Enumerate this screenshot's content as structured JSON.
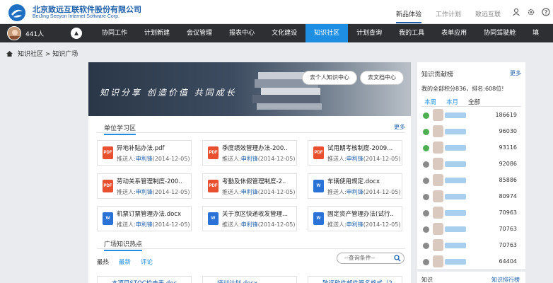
{
  "header": {
    "company_cn": "北京致远互联软件股份有限公司",
    "company_en": "BeiJing Seeyon Internet Software Corp.",
    "links": [
      "新品体验",
      "工作计划",
      "致远互联"
    ]
  },
  "nav": {
    "user_count": "441人",
    "items": [
      "协同工作",
      "计划新建",
      "会议管理",
      "报表中心",
      "文化建设",
      "知识社区",
      "计划查询",
      "我的工具",
      "表单应用",
      "协同驾驶舱",
      "填"
    ],
    "active": "知识社区"
  },
  "breadcrumb": "知识社区 > 知识广场",
  "banner": {
    "slogan": "知识分享  创造价值  共同成长",
    "btn_personal": "去个人知识中心",
    "btn_doc": "去文档中心"
  },
  "learning": {
    "title": "单位学习区",
    "more": "更多",
    "pusher_label": "推送人:",
    "cards": [
      {
        "type": "PDF",
        "name": "异地补贴办法.pdf",
        "who": "申利锋",
        "date": "(2014-12-05)"
      },
      {
        "type": "PDF",
        "name": "季度绩效管理办法-200..",
        "who": "申利锋",
        "date": "(2014-12-05)"
      },
      {
        "type": "PDF",
        "name": "试用期考核制度-2009...",
        "who": "申利锋",
        "date": "(2014-12-05)"
      },
      {
        "type": "PDF",
        "name": "劳动关系管理制度-200..",
        "who": "申利锋",
        "date": "(2014-12-05)"
      },
      {
        "type": "PDF",
        "name": "考勤及休假管理制度-2..",
        "who": "申利锋",
        "date": "(2014-12-05)"
      },
      {
        "type": "W",
        "name": "车辆使用规定.docx",
        "who": "申利锋",
        "date": "(2014-12-05)"
      },
      {
        "type": "W",
        "name": "机票订票管理办法.docx",
        "who": "申利锋",
        "date": "(2014-12-05)"
      },
      {
        "type": "W",
        "name": "关于京区快递收发管理...",
        "who": "申利锋",
        "date": "(2014-12-05)"
      },
      {
        "type": "W",
        "name": "固定资产管理办法(试行..",
        "who": "申利锋",
        "date": "(2014-12-05)"
      }
    ]
  },
  "hot": {
    "title": "广场知识热点",
    "tabs": [
      "最热",
      "最新",
      "评论"
    ],
    "search_placeholder": "--查询条件--",
    "rows": [
      "本项目STOC检查表.doc",
      "培训计划.docx",
      "致远软件邮件签名格式（2"
    ]
  },
  "contrib": {
    "title": "知识贡献榜",
    "more": "更多",
    "score": "我的全部积分836，排名:608位!",
    "tabs": [
      "本周",
      "本月",
      "全部"
    ],
    "ranks": [
      {
        "pts": "186619",
        "color": "#4caf50"
      },
      {
        "pts": "96030",
        "color": "#4caf50"
      },
      {
        "pts": "93116",
        "color": "#4caf50"
      },
      {
        "pts": "92086",
        "color": "#8a8a8a"
      },
      {
        "pts": "85886",
        "color": "#8a8a8a"
      },
      {
        "pts": "80974",
        "color": "#8a8a8a"
      },
      {
        "pts": "70963",
        "color": "#8a8a8a"
      },
      {
        "pts": "70763",
        "color": "#8a8a8a"
      },
      {
        "pts": "70763",
        "color": "#8a8a8a"
      },
      {
        "pts": "64404",
        "color": "#8a8a8a"
      }
    ]
  },
  "contrib2": {
    "title": "知识",
    "more": "知识排行榜"
  }
}
